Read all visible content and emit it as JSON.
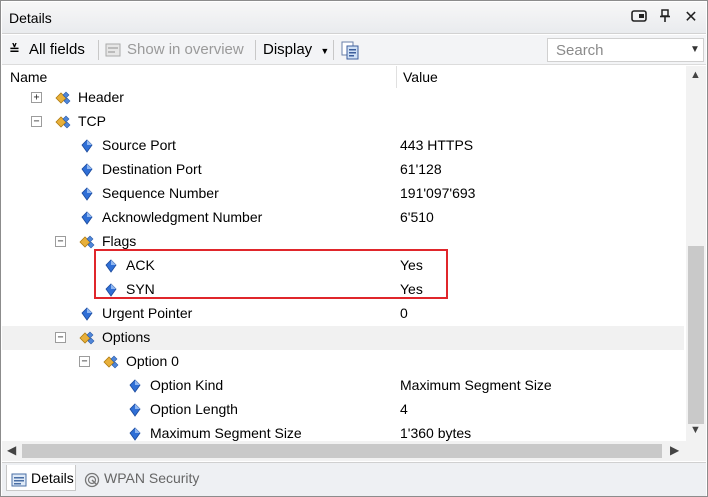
{
  "window": {
    "title": "Details"
  },
  "title_buttons": {
    "restore": "⧉",
    "pin": "𝟖",
    "close": "✕"
  },
  "toolbar": {
    "all_fields": "All fields",
    "show_in_overview": "Show in overview",
    "display": "Display",
    "search_placeholder": "Search"
  },
  "columns": {
    "name": "Name",
    "value": "Value"
  },
  "tree": {
    "header": {
      "name": "Header",
      "value": ""
    },
    "tcp": {
      "name": "TCP",
      "value": ""
    },
    "source_port": {
      "name": "Source Port",
      "value": "443 HTTPS"
    },
    "destination_port": {
      "name": "Destination Port",
      "value": "61'128"
    },
    "sequence_number": {
      "name": "Sequence Number",
      "value": "191'097'693"
    },
    "ack_number": {
      "name": "Acknowledgment Number",
      "value": "6'510"
    },
    "flags": {
      "name": "Flags",
      "value": ""
    },
    "ack": {
      "name": "ACK",
      "value": "Yes"
    },
    "syn": {
      "name": "SYN",
      "value": "Yes"
    },
    "urgent_pointer": {
      "name": "Urgent Pointer",
      "value": "0"
    },
    "options": {
      "name": "Options",
      "value": ""
    },
    "option_0": {
      "name": "Option 0",
      "value": ""
    },
    "option_kind": {
      "name": "Option Kind",
      "value": "Maximum Segment Size"
    },
    "option_length": {
      "name": "Option Length",
      "value": "4"
    },
    "max_segment_size": {
      "name": "Maximum Segment Size",
      "value": "1'360 bytes"
    }
  },
  "tabs": [
    {
      "label": "Details",
      "active": true
    },
    {
      "label": "WPAN Security",
      "active": false
    }
  ],
  "colors": {
    "highlight": "#e0262b",
    "field_icon": "#2f6fd6",
    "group_icon": "#e8b03a"
  }
}
